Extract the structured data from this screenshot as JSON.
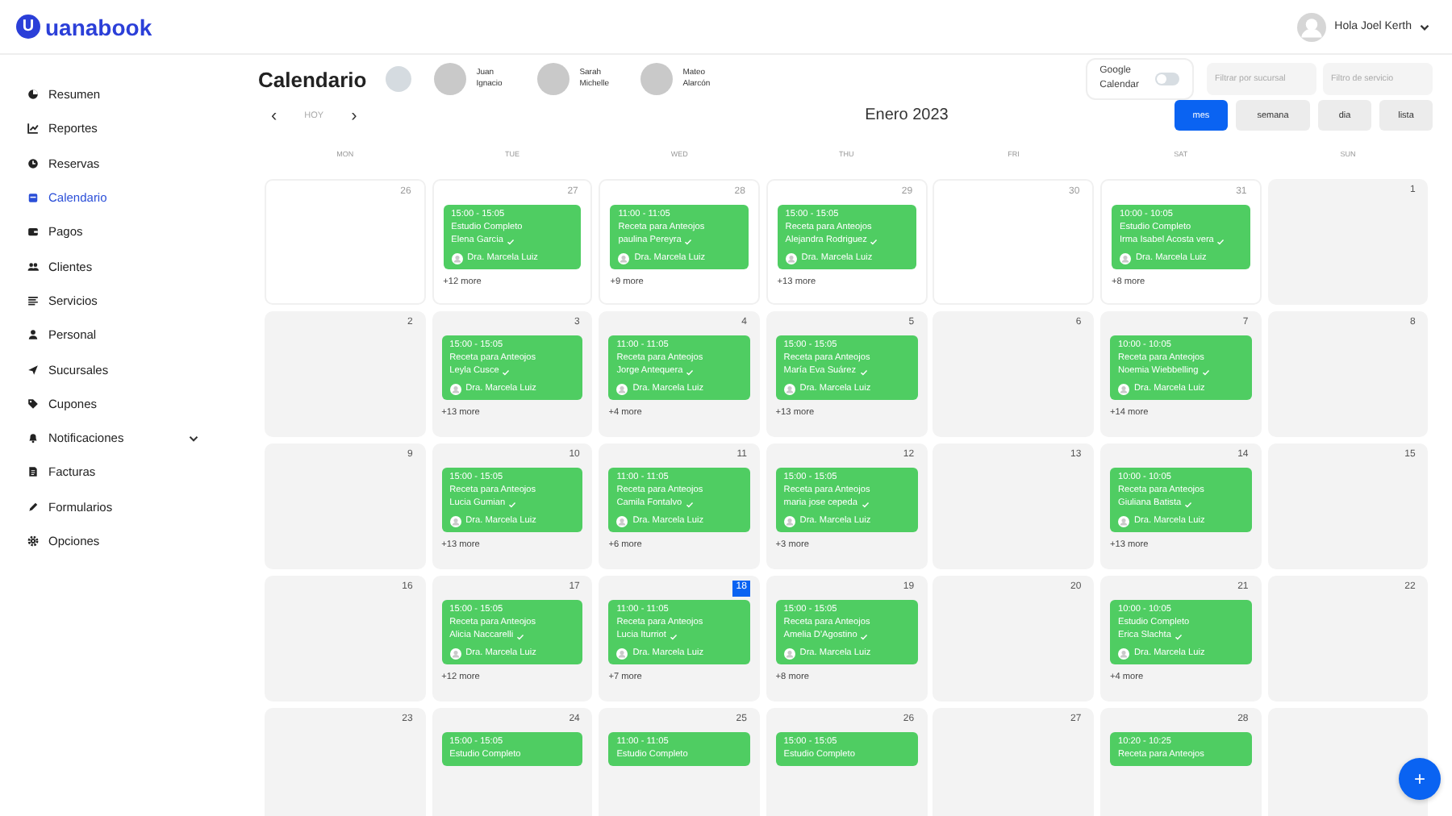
{
  "logo": {
    "mark": "U",
    "text": "uanabook"
  },
  "user": {
    "greeting": "Hola Joel Kerth"
  },
  "sidebar": {
    "items": [
      {
        "label": "Resumen",
        "selected": false
      },
      {
        "label": "Reportes",
        "selected": false
      },
      {
        "label": "Reservas",
        "selected": false
      },
      {
        "label": "Calendario",
        "selected": true
      },
      {
        "label": "Pagos",
        "selected": false
      },
      {
        "label": "Clientes",
        "selected": false
      },
      {
        "label": "Servicios",
        "selected": false
      },
      {
        "label": "Personal",
        "selected": false
      },
      {
        "label": "Sucursales",
        "selected": false
      },
      {
        "label": "Cupones",
        "selected": false
      },
      {
        "label": "Notificaciones",
        "selected": false,
        "expandable": true
      },
      {
        "label": "Facturas",
        "selected": false
      },
      {
        "label": "Formularios",
        "selected": false
      },
      {
        "label": "Opciones",
        "selected": false
      }
    ]
  },
  "page_title": "Calendario",
  "staff": [
    {
      "first": "Juan",
      "last": "Ignacio"
    },
    {
      "first": "Sarah",
      "last": "Michelle"
    },
    {
      "first": "Mateo",
      "last": "Alarcón"
    }
  ],
  "google_calendar": {
    "label_1": "Google",
    "label_2": "Calendar",
    "on": false
  },
  "filters": [
    {
      "placeholder": "Filtrar por sucursal"
    },
    {
      "placeholder": "Filtro de servicio"
    }
  ],
  "nav": {
    "prev": "‹",
    "today": "HOY",
    "next": "›",
    "month": "Enero 2023"
  },
  "views": [
    {
      "label": "mes",
      "selected": true
    },
    {
      "label": "semana",
      "selected": false
    },
    {
      "label": "dia",
      "selected": false
    },
    {
      "label": "lista",
      "selected": false
    }
  ],
  "weekdays": [
    "MON",
    "TUE",
    "WED",
    "THU",
    "FRI",
    "SAT",
    "SUN"
  ],
  "weeks": [
    [
      {
        "number": "26",
        "outside": true,
        "today": false
      },
      {
        "number": "27",
        "outside": true,
        "today": false,
        "events": [
          {
            "time": "15:00 - 15:05",
            "title": "Estudio Completo",
            "patient": "Elena Garcia",
            "confirmed": true,
            "doctor": "Dra. Marcela Luiz"
          }
        ],
        "more": "+12 more"
      },
      {
        "number": "28",
        "outside": true,
        "today": false,
        "events": [
          {
            "time": "11:00 - 11:05",
            "title": "Receta para Anteojos",
            "patient": "paulina Pereyra",
            "confirmed": true,
            "doctor": "Dra. Marcela Luiz"
          }
        ],
        "more": "+9 more"
      },
      {
        "number": "29",
        "outside": true,
        "today": false,
        "events": [
          {
            "time": "15:00 - 15:05",
            "title": "Receta para Anteojos",
            "patient": "Alejandra Rodriguez",
            "confirmed": true,
            "doctor": "Dra. Marcela Luiz"
          }
        ],
        "more": "+13 more"
      },
      {
        "number": "30",
        "outside": true,
        "today": false
      },
      {
        "number": "31",
        "outside": true,
        "today": false,
        "events": [
          {
            "time": "10:00 - 10:05",
            "title": "Estudio Completo",
            "patient": "Irma Isabel Acosta vera",
            "confirmed": true,
            "doctor": "Dra. Marcela Luiz"
          }
        ],
        "more": "+8 more"
      },
      {
        "number": "1",
        "outside": false,
        "today": false
      }
    ],
    [
      {
        "number": "2",
        "outside": false,
        "today": false
      },
      {
        "number": "3",
        "outside": false,
        "today": false,
        "events": [
          {
            "time": "15:00 - 15:05",
            "title": "Receta para Anteojos",
            "patient": "Leyla Cusce",
            "confirmed": true,
            "doctor": "Dra. Marcela Luiz"
          }
        ],
        "more": "+13 more"
      },
      {
        "number": "4",
        "outside": false,
        "today": false,
        "events": [
          {
            "time": "11:00 - 11:05",
            "title": "Receta para Anteojos",
            "patient": "Jorge Antequera",
            "confirmed": true,
            "doctor": "Dra. Marcela Luiz"
          }
        ],
        "more": "+4 more"
      },
      {
        "number": "5",
        "outside": false,
        "today": false,
        "events": [
          {
            "time": "15:00 - 15:05",
            "title": "Receta para Anteojos",
            "patient": "María Eva Suárez",
            "confirmed": true,
            "doctor": "Dra. Marcela Luiz"
          }
        ],
        "more": "+13 more"
      },
      {
        "number": "6",
        "outside": false,
        "today": false
      },
      {
        "number": "7",
        "outside": false,
        "today": false,
        "events": [
          {
            "time": "10:00 - 10:05",
            "title": "Receta para Anteojos",
            "patient": "Noemia Wiebbelling",
            "confirmed": true,
            "doctor": "Dra. Marcela Luiz"
          }
        ],
        "more": "+14 more"
      },
      {
        "number": "8",
        "outside": false,
        "today": false
      }
    ],
    [
      {
        "number": "9",
        "outside": false,
        "today": false
      },
      {
        "number": "10",
        "outside": false,
        "today": false,
        "events": [
          {
            "time": "15:00 - 15:05",
            "title": "Receta para Anteojos",
            "patient": "Lucia Gumian",
            "confirmed": true,
            "doctor": "Dra. Marcela Luiz"
          }
        ],
        "more": "+13 more"
      },
      {
        "number": "11",
        "outside": false,
        "today": false,
        "events": [
          {
            "time": "11:00 - 11:05",
            "title": "Receta para Anteojos",
            "patient": "Camila Fontalvo",
            "confirmed": true,
            "doctor": "Dra. Marcela Luiz"
          }
        ],
        "more": "+6 more"
      },
      {
        "number": "12",
        "outside": false,
        "today": false,
        "events": [
          {
            "time": "15:00 - 15:05",
            "title": "Receta para Anteojos",
            "patient": "maria jose cepeda",
            "confirmed": true,
            "doctor": "Dra. Marcela Luiz"
          }
        ],
        "more": "+3 more"
      },
      {
        "number": "13",
        "outside": false,
        "today": false
      },
      {
        "number": "14",
        "outside": false,
        "today": false,
        "events": [
          {
            "time": "10:00 - 10:05",
            "title": "Receta para Anteojos",
            "patient": "Giuliana Batista",
            "confirmed": true,
            "doctor": "Dra. Marcela Luiz"
          }
        ],
        "more": "+13 more"
      },
      {
        "number": "15",
        "outside": false,
        "today": false
      }
    ],
    [
      {
        "number": "16",
        "outside": false,
        "today": false
      },
      {
        "number": "17",
        "outside": false,
        "today": false,
        "events": [
          {
            "time": "15:00 - 15:05",
            "title": "Receta para Anteojos",
            "patient": "Alicia Naccarelli",
            "confirmed": true,
            "doctor": "Dra. Marcela Luiz"
          }
        ],
        "more": "+12 more"
      },
      {
        "number": "18",
        "outside": false,
        "today": true,
        "events": [
          {
            "time": "11:00 - 11:05",
            "title": "Receta para Anteojos",
            "patient": "Lucia Iturriot",
            "confirmed": true,
            "doctor": "Dra. Marcela Luiz"
          }
        ],
        "more": "+7 more"
      },
      {
        "number": "19",
        "outside": false,
        "today": false,
        "events": [
          {
            "time": "15:00 - 15:05",
            "title": "Receta para Anteojos",
            "patient": "Amelia D'Agostino",
            "confirmed": true,
            "doctor": "Dra. Marcela Luiz"
          }
        ],
        "more": "+8 more"
      },
      {
        "number": "20",
        "outside": false,
        "today": false
      },
      {
        "number": "21",
        "outside": false,
        "today": false,
        "events": [
          {
            "time": "10:00 - 10:05",
            "title": "Estudio Completo",
            "patient": "Erica Slachta",
            "confirmed": true,
            "doctor": "Dra. Marcela Luiz"
          }
        ],
        "more": "+4 more"
      },
      {
        "number": "22",
        "outside": false,
        "today": false
      }
    ],
    [
      {
        "number": "23",
        "outside": false,
        "today": false
      },
      {
        "number": "24",
        "outside": false,
        "today": false,
        "events": [
          {
            "time": "15:00 - 15:05",
            "title": "Estudio Completo"
          }
        ]
      },
      {
        "number": "25",
        "outside": false,
        "today": false,
        "events": [
          {
            "time": "11:00 - 11:05",
            "title": "Estudio Completo"
          }
        ]
      },
      {
        "number": "26",
        "outside": false,
        "today": false,
        "events": [
          {
            "time": "15:00 - 15:05",
            "title": "Estudio Completo"
          }
        ]
      },
      {
        "number": "27",
        "outside": false,
        "today": false
      },
      {
        "number": "28",
        "outside": false,
        "today": false,
        "events": [
          {
            "time": "10:20 - 10:25",
            "title": "Receta para Anteojos"
          }
        ]
      },
      {
        "outside": false
      }
    ]
  ],
  "fab": "+"
}
